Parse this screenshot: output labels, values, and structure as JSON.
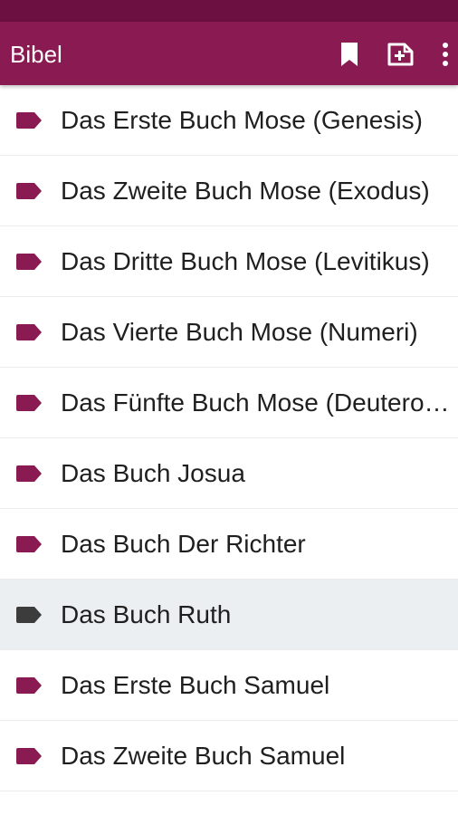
{
  "app_bar": {
    "title": "Bibel",
    "background": "#8a1a52",
    "status_bar_color": "#6b1040",
    "icons": [
      "bookmark-icon",
      "add-to-document-icon",
      "more-vert-icon"
    ]
  },
  "colors": {
    "tag_default": "#8a1a52",
    "tag_selected": "#3c3c3c",
    "selected_row": "#eceff1"
  },
  "books": [
    {
      "label": "Das Erste Buch Mose (Genesis)",
      "selected": false
    },
    {
      "label": "Das Zweite Buch Mose (Exodus)",
      "selected": false
    },
    {
      "label": "Das Dritte Buch Mose (Levitikus)",
      "selected": false
    },
    {
      "label": "Das Vierte Buch Mose (Numeri)",
      "selected": false
    },
    {
      "label": "Das Fünfte Buch Mose (Deuteronomium)",
      "selected": false
    },
    {
      "label": "Das Buch Josua",
      "selected": false
    },
    {
      "label": "Das Buch Der Richter",
      "selected": false
    },
    {
      "label": "Das Buch Ruth",
      "selected": true
    },
    {
      "label": "Das Erste Buch Samuel",
      "selected": false
    },
    {
      "label": "Das Zweite Buch Samuel",
      "selected": false
    }
  ]
}
